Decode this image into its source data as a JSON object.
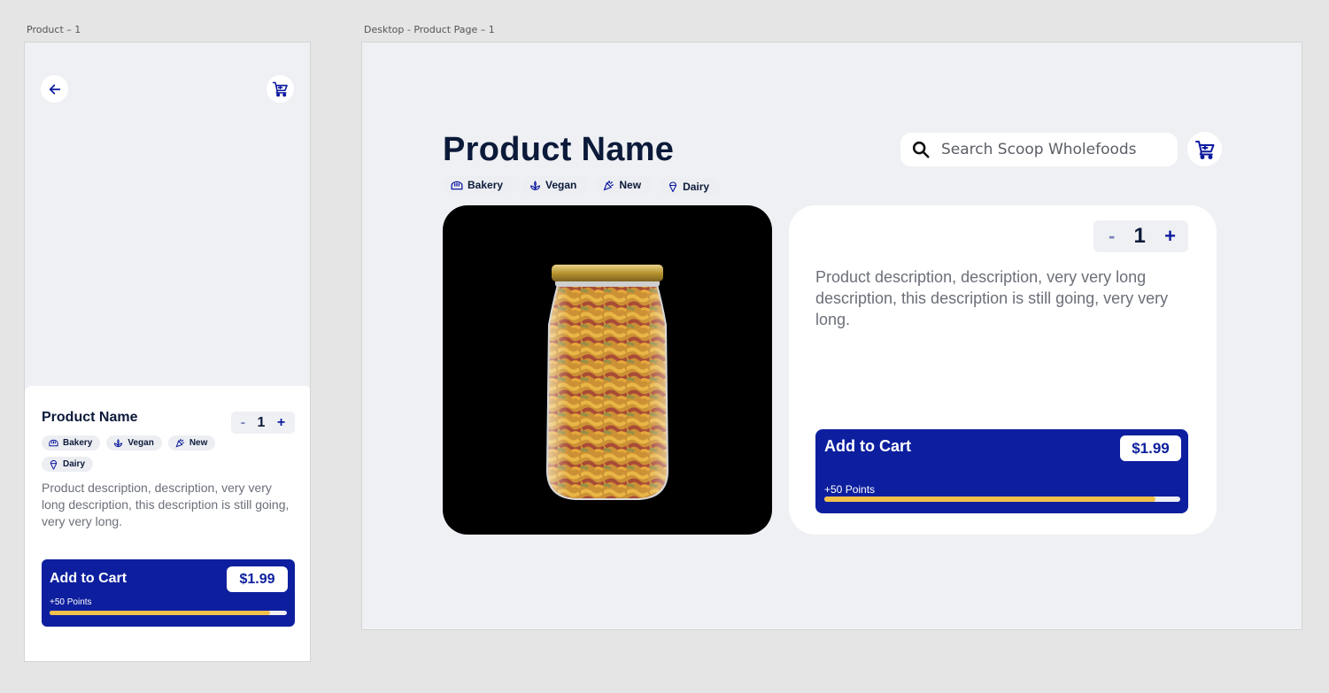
{
  "frames": {
    "mobile_label": "Product – 1",
    "desktop_label": "Desktop - Product Page – 1"
  },
  "product": {
    "name": "Product Name",
    "description": "Product description, description, very very long description, this description is still going, very very long.",
    "quantity": "1",
    "minus": "-",
    "plus": "+",
    "tags": [
      {
        "label": "Bakery",
        "icon": "bread-icon"
      },
      {
        "label": "Vegan",
        "icon": "leaf-icon"
      },
      {
        "label": "New",
        "icon": "party-popper-icon"
      },
      {
        "label": "Dairy",
        "icon": "ice-cream-icon"
      }
    ]
  },
  "cart": {
    "label": "Add to Cart",
    "price": "$1.99",
    "points": "+50 Points",
    "points_progress": 0.93
  },
  "search": {
    "placeholder": "Search Scoop Wholefoods"
  },
  "icons": {
    "back": "arrow-left-icon",
    "cart": "shopping-cart-icon",
    "search": "search-icon"
  },
  "colors": {
    "primary": "#0d1f9e",
    "text_dark": "#0c1a3a",
    "accent_yellow": "#f2c14b",
    "background": "#eef0f3"
  }
}
